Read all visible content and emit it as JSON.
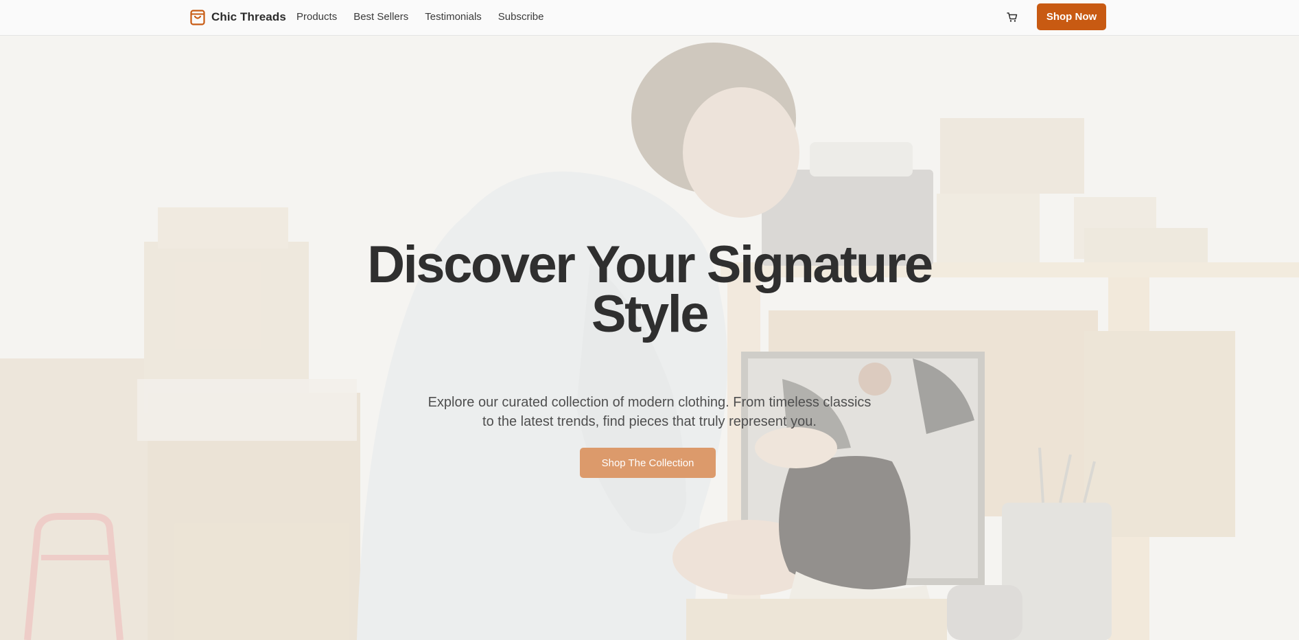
{
  "brand": {
    "name": "Chic Threads",
    "icon": "shopping-bag-icon",
    "accent": "#c85a12"
  },
  "nav": {
    "items": [
      {
        "label": "Products"
      },
      {
        "label": "Best Sellers"
      },
      {
        "label": "Testimonials"
      },
      {
        "label": "Subscribe"
      }
    ]
  },
  "header_actions": {
    "cart_icon": "cart-icon",
    "shop_now_label": "Shop Now",
    "shop_now_color": "#c85a12"
  },
  "hero": {
    "title_line1": "Discover Your Signature",
    "title_line2": "Style",
    "subtitle": "Explore our curated collection of modern clothing. From timeless classics to the latest trends, find pieces that truly represent you.",
    "cta_label": "Shop The Collection",
    "cta_color": "#dc9a6b",
    "background_image": "man-packing-shoes-photo"
  }
}
